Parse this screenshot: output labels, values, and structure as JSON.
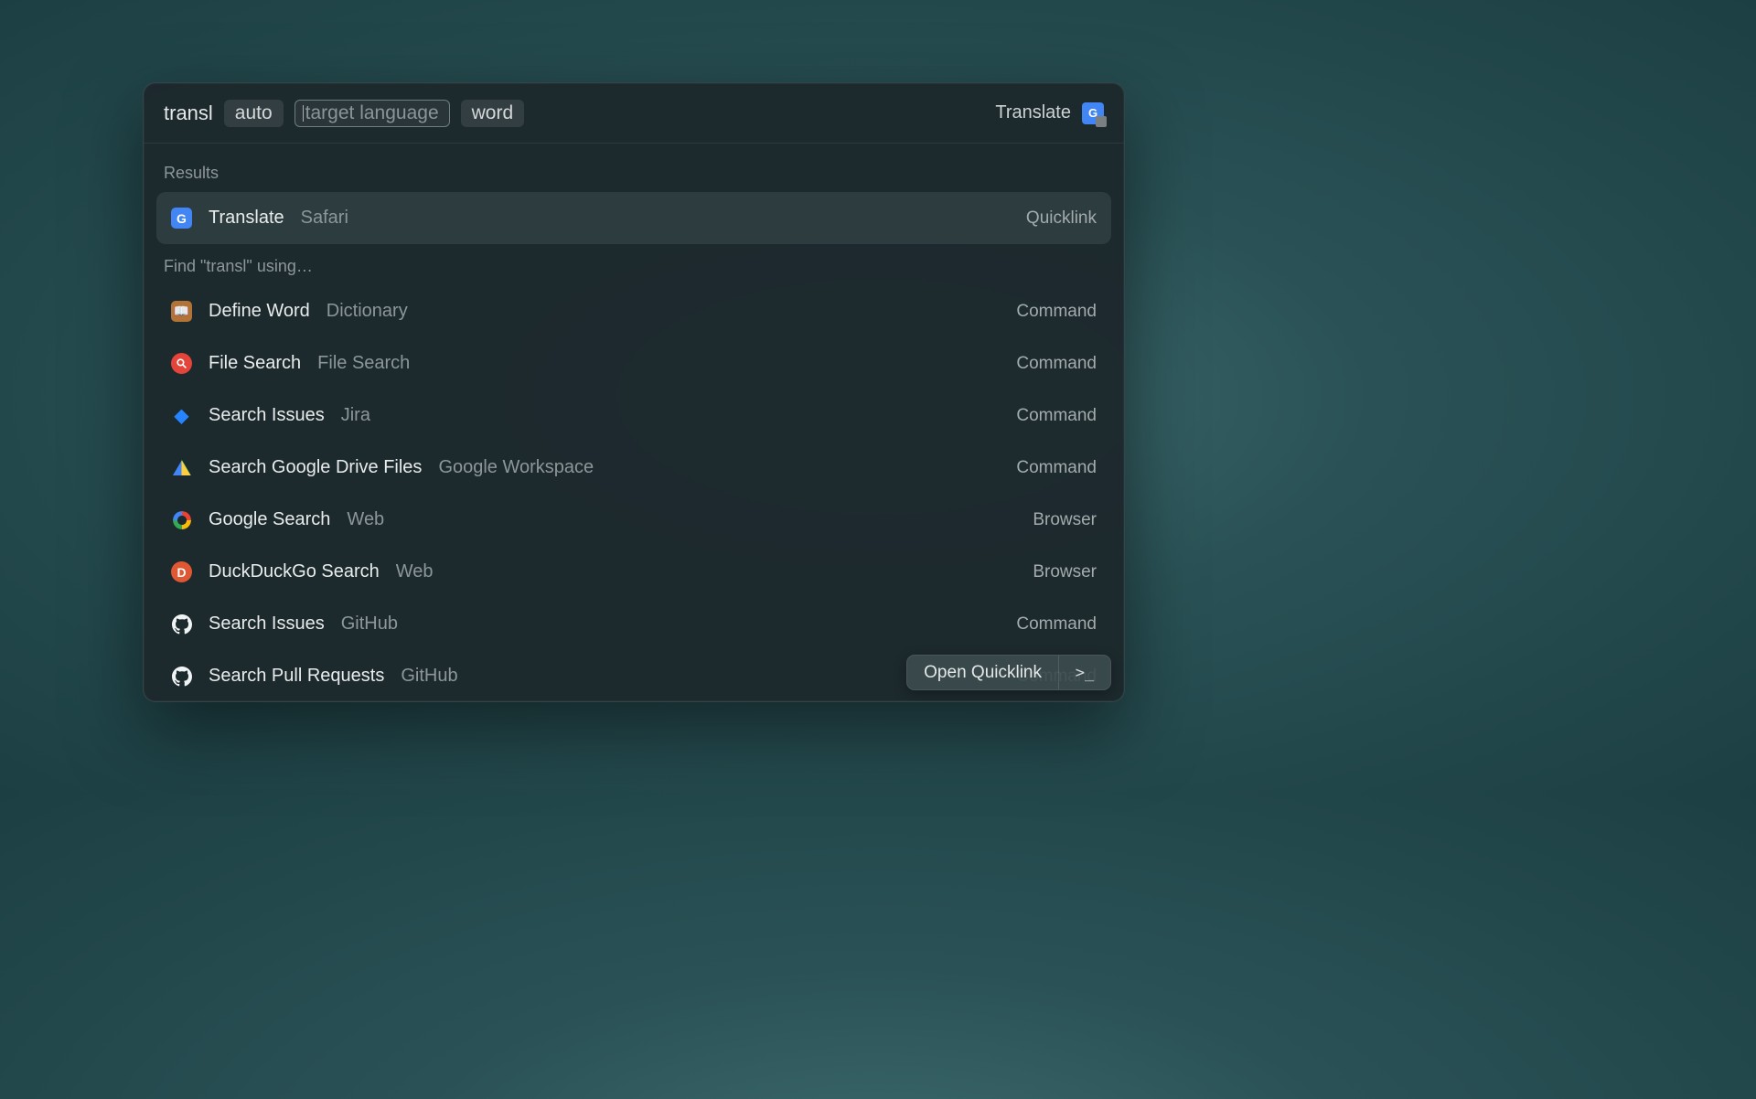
{
  "search": {
    "query": "transl",
    "token_auto": "auto",
    "token_target_placeholder": "target language",
    "token_word": "word",
    "right_label": "Translate"
  },
  "sections": {
    "results_label": "Results",
    "find_label": "Find \"transl\" using…"
  },
  "rows": [
    {
      "title": "Translate",
      "sub": "Safari",
      "type": "Quicklink",
      "icon": "gt",
      "selected": true
    },
    {
      "title": "Define Word",
      "sub": "Dictionary",
      "type": "Command",
      "icon": "dict"
    },
    {
      "title": "File Search",
      "sub": "File Search",
      "type": "Command",
      "icon": "file"
    },
    {
      "title": "Search Issues",
      "sub": "Jira",
      "type": "Command",
      "icon": "jira"
    },
    {
      "title": "Search Google Drive Files",
      "sub": "Google Workspace",
      "type": "Command",
      "icon": "drive"
    },
    {
      "title": "Google Search",
      "sub": "Web",
      "type": "Browser",
      "icon": "google"
    },
    {
      "title": "DuckDuckGo Search",
      "sub": "Web",
      "type": "Browser",
      "icon": "ddg"
    },
    {
      "title": "Search Issues",
      "sub": "GitHub",
      "type": "Command",
      "icon": "github"
    },
    {
      "title": "Search Pull Requests",
      "sub": "GitHub",
      "type": "Command",
      "icon": "github"
    }
  ],
  "footer": {
    "label": "Open Quicklink",
    "shortcut": ">_"
  }
}
